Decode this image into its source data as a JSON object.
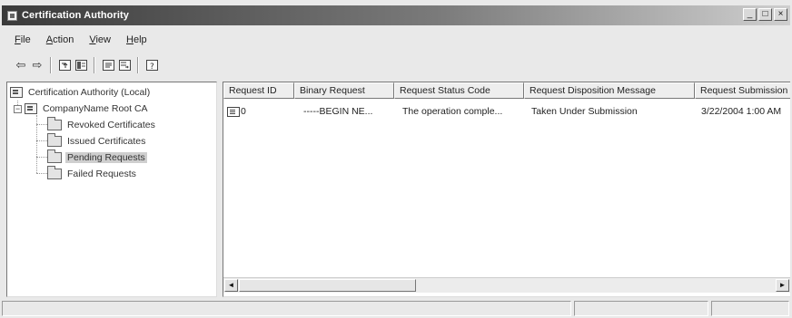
{
  "window": {
    "title": "Certification Authority",
    "buttons": {
      "minimize": "_",
      "maximize": "□",
      "close": "×"
    }
  },
  "menu": [
    {
      "label": "File",
      "accel": "F",
      "rest": "ile"
    },
    {
      "label": "Action",
      "accel": "A",
      "rest": "ction"
    },
    {
      "label": "View",
      "accel": "V",
      "rest": "iew"
    },
    {
      "label": "Help",
      "accel": "H",
      "rest": "elp"
    }
  ],
  "toolbar": {
    "back_icon": "back-arrow-icon",
    "forward_icon": "forward-arrow-icon",
    "back_glyph": "⇦",
    "forward_glyph": "⇨"
  },
  "tree": {
    "root": "Certification Authority (Local)",
    "ca": {
      "label": "CompanyName Root CA",
      "expander": "−"
    },
    "folders": [
      "Revoked Certificates",
      "Issued Certificates",
      "Pending Requests",
      "Failed Requests"
    ],
    "selected_index": 2
  },
  "table": {
    "columns": [
      "Request ID",
      "Binary Request",
      "Request Status Code",
      "Request Disposition Message",
      "Request Submission Date"
    ],
    "rows": [
      {
        "request_id": "0",
        "binary_request": "-----BEGIN NE...",
        "status_code": "The operation comple...",
        "disposition": "Taken Under Submission",
        "submission_date": "3/22/2004 1:00 AM"
      }
    ]
  },
  "scrollbar": {
    "left_glyph": "◄",
    "right_glyph": "►"
  }
}
